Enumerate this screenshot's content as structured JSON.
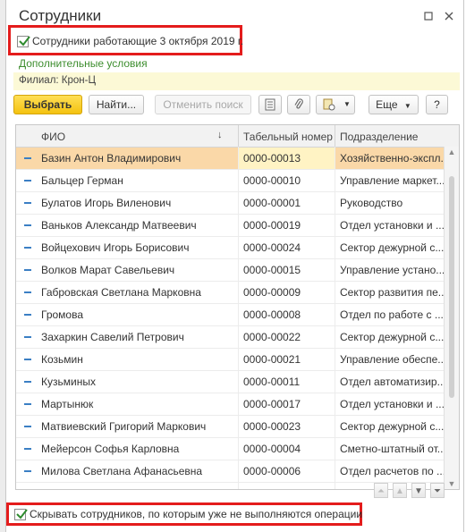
{
  "window": {
    "title": "Сотрудники"
  },
  "top_checkbox": {
    "label": "Сотрудники работающие 3 октября 2019 г.",
    "checked": true
  },
  "extra_conditions_link": "Дополнительные условия",
  "filter_text": "Филиал: Крон-Ц",
  "toolbar": {
    "select_label": "Выбрать",
    "find_label": "Найти...",
    "cancel_search_label": "Отменить поиск",
    "more_label": "Еще",
    "help_label": "?"
  },
  "table": {
    "columns": [
      "ФИО",
      "Табельный номер",
      "Подразделение"
    ],
    "rows": [
      {
        "name": "Базин Антон Владимирович",
        "number": "0000-00013",
        "dept": "Хозяйственно-экспл...",
        "selected": true
      },
      {
        "name": "Бальцер Герман",
        "number": "0000-00010",
        "dept": "Управление маркет..."
      },
      {
        "name": "Булатов Игорь Виленович",
        "number": "0000-00001",
        "dept": "Руководство"
      },
      {
        "name": "Ваньков Александр Матвеевич",
        "number": "0000-00019",
        "dept": "Отдел установки и ..."
      },
      {
        "name": "Войцехович Игорь Борисович",
        "number": "0000-00024",
        "dept": "Сектор дежурной с..."
      },
      {
        "name": "Волков Марат Савельевич",
        "number": "0000-00015",
        "dept": "Управление устано..."
      },
      {
        "name": "Габровская Светлана Марковна",
        "number": "0000-00009",
        "dept": "Сектор развития пе..."
      },
      {
        "name": "Громова",
        "number": "0000-00008",
        "dept": "Отдел по работе с ..."
      },
      {
        "name": "Захаркин Савелий Петрович",
        "number": "0000-00022",
        "dept": "Сектор дежурной с..."
      },
      {
        "name": "Козьмин",
        "number": "0000-00021",
        "dept": "Управление обеспе..."
      },
      {
        "name": "Кузьминых",
        "number": "0000-00011",
        "dept": "Отдел автоматизир..."
      },
      {
        "name": "Мартынюк",
        "number": "0000-00017",
        "dept": "Отдел установки и ..."
      },
      {
        "name": "Матвиевский Григорий Маркович",
        "number": "0000-00023",
        "dept": "Сектор дежурной с..."
      },
      {
        "name": "Мейерсон Софья Карловна",
        "number": "0000-00004",
        "dept": "Сметно-штатный от..."
      },
      {
        "name": "Милова Светлана Афанасьевна",
        "number": "0000-00006",
        "dept": "Отдел расчетов по ..."
      }
    ]
  },
  "bottom_checkbox": {
    "label": "Скрывать сотрудников, по которым уже не выполняются операции",
    "checked": true
  },
  "colors": {
    "accent_yellow": "#f4c210",
    "selected_row": "#fad8a8",
    "link_green": "#3e8e2f",
    "highlight_red": "#e41c1c"
  },
  "icons": [
    "maximize-icon",
    "close-icon",
    "list-icon",
    "paperclip-icon",
    "document-settings-icon",
    "dropdown-arrow-icon",
    "sort-arrow-icon",
    "row-marker-icon"
  ]
}
